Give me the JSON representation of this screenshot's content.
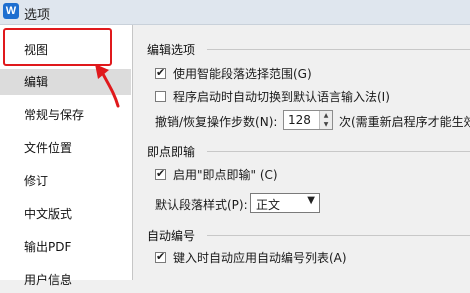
{
  "window": {
    "title": "选项",
    "logo_letter": "W"
  },
  "sidebar": {
    "items": [
      {
        "label": "视图"
      },
      {
        "label": "编辑"
      },
      {
        "label": "常规与保存"
      },
      {
        "label": "文件位置"
      },
      {
        "label": "修订"
      },
      {
        "label": "中文版式"
      },
      {
        "label": "输出PDF"
      },
      {
        "label": "用户信息"
      }
    ],
    "selected": "编辑"
  },
  "content": {
    "edit_section": {
      "title": "编辑选项",
      "smart_paragraph": {
        "label": "使用智能段落选择范围(G)",
        "checked": true
      },
      "auto_ime": {
        "label": "程序启动时自动切换到默认语言输入法(I)",
        "checked": false
      },
      "undo_steps": {
        "label": "撤销/恢复操作步数(N):",
        "value": "128",
        "note": "次(需重新启程序才能生效"
      }
    },
    "click_type_section": {
      "title": "即点即输",
      "enable": {
        "label": "启用\"即点即输\" (C)",
        "checked": true
      },
      "default_style": {
        "label": "默认段落样式(P):",
        "value": "正文"
      }
    },
    "auto_number_section": {
      "title": "自动编号",
      "auto_list": {
        "label": "键入时自动应用自动编号列表(A)",
        "checked": true
      }
    }
  },
  "colors": {
    "highlight": "#e0191c",
    "selected_bg": "#dcdcdc",
    "logo_blue": "#1e6fd0"
  },
  "icons": {
    "checkbox_tick": "✔",
    "spin_up": "▲",
    "spin_down": "▼",
    "dropdown": "▼"
  }
}
